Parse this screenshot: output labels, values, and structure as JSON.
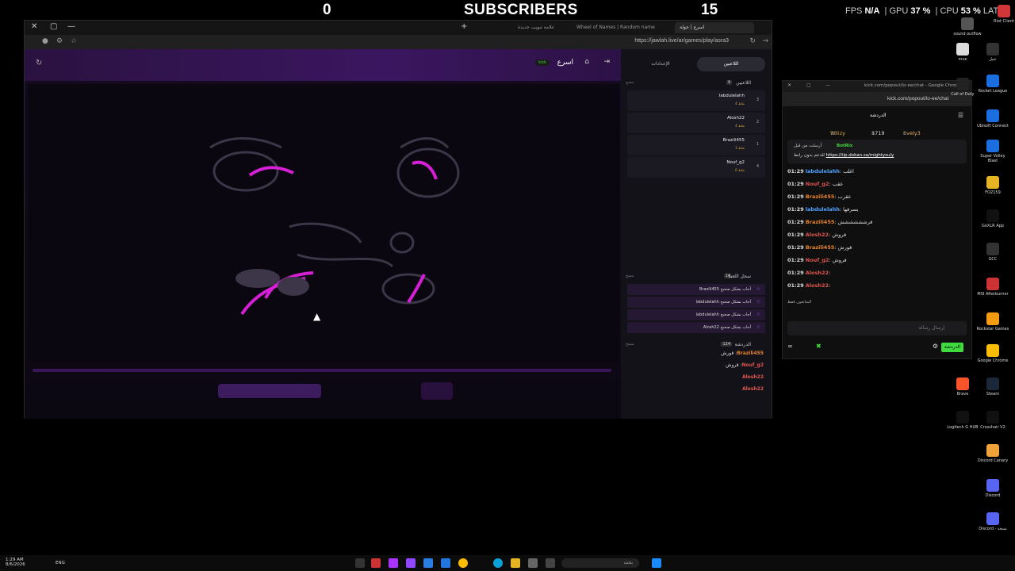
{
  "overlay": {
    "left_number": "0",
    "title": "SUBSCRIBERS",
    "right_number": "15",
    "fps_label": "FPS",
    "fps_value": "N/A",
    "gpu_label": "GPU",
    "gpu_value": "37 %",
    "cpu_label": "CPU",
    "cpu_value": "53 %",
    "lat_label": "LAT"
  },
  "browser": {
    "tabs": [
      {
        "label": "اسرع | جولة",
        "active": true
      },
      {
        "label": "Wheel of Names | Random name"
      },
      {
        "label": "علامة تبويب جديدة"
      }
    ],
    "url": "https://jawlah.live/ar/games/play/asra3"
  },
  "game": {
    "title": "اسرع",
    "badge": "kick"
  },
  "side": {
    "tab_players": "اللاعبين",
    "tab_settings": "الإعدادات",
    "players_header": "اللاعبين",
    "players_count": "4",
    "clear": "مسح",
    "players": [
      {
        "rank": "3",
        "name": "labdulelahh",
        "sub": "4 نقاط"
      },
      {
        "rank": "2",
        "name": "Alosh22",
        "sub": "4 نقاط"
      },
      {
        "rank": "1",
        "name": "Brazili455",
        "sub": "3 نقاط"
      },
      {
        "rank": "4",
        "name": "Nouf_g2",
        "sub": "0 نقاط"
      }
    ],
    "log_header": "سجل اللعبة",
    "log_count": "14",
    "log": [
      "Brazili455 أجاب بشكل صحيح",
      "labdulelahh أجاب بشكل صحيح",
      "labdulelahh أجاب بشكل صحيح",
      "Alosh22 أجاب بشكل صحيح"
    ],
    "chat_header": "الدردشة",
    "chat_count": "124",
    "chat": [
      {
        "user": "Brazili455",
        "text": "قورش"
      },
      {
        "user": "Nouf_g2",
        "text": "قروش"
      },
      {
        "user": "Alosh22",
        "text": ""
      },
      {
        "user": "Alosh22",
        "text": ""
      }
    ]
  },
  "kick_chat": {
    "window_title": "kick.com/popout/lo-ee/chat - Google Chrome",
    "url": "kick.com/popout/lo-ee/chat",
    "header": "الدردشة",
    "gifters": [
      {
        "name": "Wiiizy",
        "count": "10"
      },
      {
        "name": "1719",
        "count": "8"
      },
      {
        "name": "Evely3",
        "count": "5"
      }
    ],
    "pinned_label": "أرسلت من قبل",
    "pinned_user": "BotRix",
    "pinned_text": "https://tip.dokan.sa/mightysuly",
    "pinned_prefix": "للدعم بدون رابط",
    "messages": [
      {
        "time": "01:29",
        "user": "labdulelahh",
        "text": "اغلب",
        "color": "#4fa3ff"
      },
      {
        "time": "01:29",
        "user": "Nouf_g2",
        "text": "عقب",
        "color": "#e0554f"
      },
      {
        "time": "01:29",
        "user": "Brazili455",
        "text": "عقرب",
        "color": "#e8832a"
      },
      {
        "time": "01:29",
        "user": "labdulelahh",
        "text": "يسرفها",
        "color": "#4fa3ff"
      },
      {
        "time": "01:29",
        "user": "Brazili455",
        "text": "قرشششششش",
        "color": "#e8832a"
      },
      {
        "time": "01:29",
        "user": "Alosh22",
        "text": "قروش",
        "color": "#e0554f"
      },
      {
        "time": "01:29",
        "user": "Brazili455",
        "text": "قورش",
        "color": "#e8832a"
      },
      {
        "time": "01:29",
        "user": "Nouf_g2",
        "text": "قروش",
        "color": "#e0554f"
      },
      {
        "time": "01:29",
        "user": "Alosh22",
        "text": "",
        "color": "#e0554f"
      },
      {
        "time": "01:29",
        "user": "Alosh22",
        "text": "",
        "color": "#e0554f"
      }
    ],
    "active_label": "المتابعون فقط",
    "input_placeholder": "إرسال رسالة",
    "send_label": "الدردشة"
  },
  "desktop_icons": [
    "Riot Client",
    "sound outflow",
    "mve",
    "عتيل",
    "Call of Duty",
    "Rocket League",
    "Ubisoft Connect",
    "Super Volley Blast",
    "FO2159",
    "GoXLR App",
    "GCC",
    "MSI Afterburner",
    "Rockstar Games",
    "Google Chrome",
    "Steam",
    "Brave",
    "Crosshair V2",
    "Logitech G HUB",
    "Discord Canary",
    "Discord",
    "Discord - نسخة"
  ],
  "taskbar": {
    "time": "1:29 AM",
    "date": "8/6/2026",
    "lang": "ENG",
    "search_placeholder": "بحث"
  }
}
